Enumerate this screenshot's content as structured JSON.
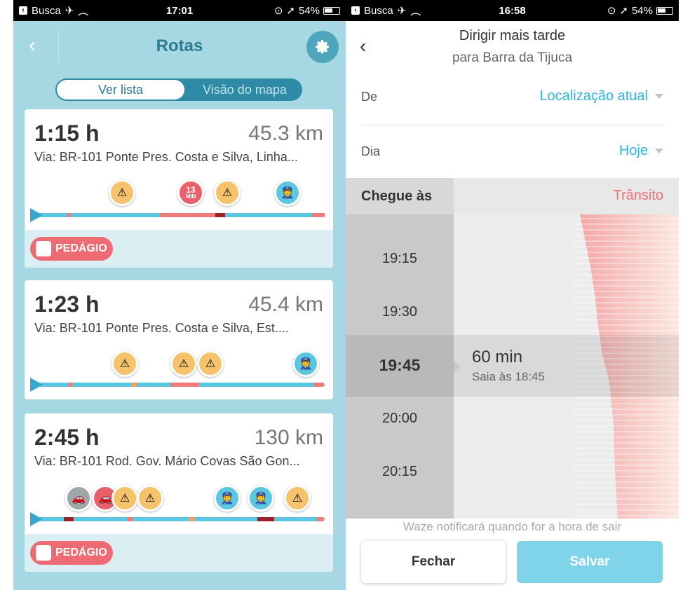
{
  "left": {
    "status": {
      "back_app": "Busca",
      "time": "17:01",
      "battery": "54%"
    },
    "header": {
      "title": "Rotas"
    },
    "toggle": {
      "active": "Ver lista",
      "inactive": "Visão do mapa"
    },
    "routes": [
      {
        "duration": "1:15 h",
        "distance": "45.3 km",
        "via": "Via: BR-101 Ponte Pres. Costa e Silva, Linha...",
        "toll": "PEDÁGIO",
        "jam_label_top": "13",
        "jam_label_bottom": "MIN"
      },
      {
        "duration": "1:23 h",
        "distance": "45.4 km",
        "via": "Via: BR-101 Ponte Pres. Costa e Silva, Est...."
      },
      {
        "duration": "2:45 h",
        "distance": "130 km",
        "via": "Via: BR-101 Rod. Gov. Mário Covas São Gon...",
        "toll": "PEDÁGIO"
      }
    ]
  },
  "right": {
    "status": {
      "back_app": "Busca",
      "time": "16:58",
      "battery": "54%"
    },
    "header": {
      "title": "Dirigir mais tarde",
      "subtitle": "para Barra da Tijuca"
    },
    "from": {
      "label": "De",
      "value": "Localização atual"
    },
    "day": {
      "label": "Dia",
      "value": "Hoje"
    },
    "schedule": {
      "arrive_label": "Chegue às",
      "traffic_label": "Trânsito",
      "times": [
        "19:15",
        "19:30",
        "19:45",
        "20:00",
        "20:15"
      ],
      "selected": {
        "duration": "60 min",
        "leave": "Saia às 18:45"
      }
    },
    "notice": "Waze notificará quando for a hora de sair",
    "buttons": {
      "close": "Fechar",
      "save": "Salvar"
    }
  },
  "colors": {
    "accent": "#2eb6d9",
    "traffic": "#e87474",
    "toll": "#ef6b74",
    "route": "#5bc7e0"
  }
}
